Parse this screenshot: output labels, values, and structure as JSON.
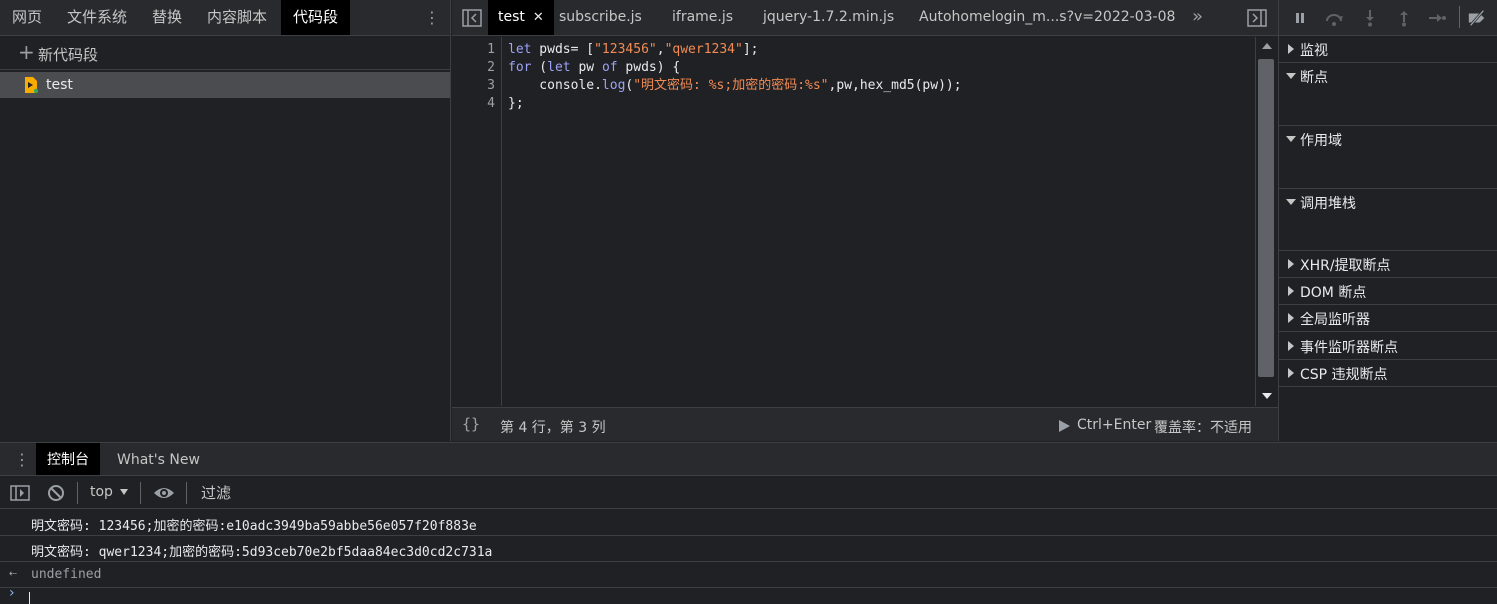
{
  "navigator": {
    "tabs": [
      "网页",
      "文件系统",
      "替换",
      "内容脚本",
      "代码段"
    ],
    "more_glyph": "⋮",
    "new_snippet_label": "新代码段",
    "snippet_name": "test"
  },
  "editor": {
    "tabs": [
      {
        "label": "test",
        "close": "✕"
      },
      {
        "label": "subscribe.js"
      },
      {
        "label": "iframe.js"
      },
      {
        "label": "jquery-1.7.2.min.js"
      },
      {
        "label": "Autohomelogin_m...s?v=2022-03-08"
      }
    ],
    "overflow_glyph": "»",
    "line_numbers": [
      "1",
      "2",
      "3",
      "4"
    ],
    "code": {
      "l1": {
        "kw": "let",
        "a": " pwds= [",
        "s1": "\"123456\"",
        "b": ",",
        "s2": "\"qwer1234\"",
        "c": "];"
      },
      "l2": {
        "kw1": "for",
        "a": " (",
        "kw2": "let",
        "b": " pw ",
        "kw3": "of",
        "c": " pwds) {"
      },
      "l3": {
        "a": "    console.",
        "fn": "log",
        "b": "(",
        "s": "\"明文密码: %s;加密的密码:%s\"",
        "c": ",pw,hex_md5(pw));"
      },
      "l4": {
        "a": "};"
      }
    },
    "status": {
      "pretty_print": "{}",
      "cursor_position": "第 4 行，第 3 列",
      "run_shortcut": "Ctrl+Enter",
      "coverage": "覆盖率：不适用"
    }
  },
  "debugger": {
    "sections": [
      "监视",
      "断点",
      "作用域",
      "调用堆栈",
      "XHR/提取断点",
      "DOM 断点",
      "全局监听器",
      "事件监听器断点",
      "CSP 违规断点"
    ]
  },
  "drawer": {
    "menu_glyph": "⋮",
    "tabs": [
      "控制台",
      "What's New"
    ]
  },
  "console": {
    "context": "top",
    "filter_placeholder": "过滤",
    "messages": [
      "明文密码: 123456;加密的密码:e10adc3949ba59abbe56e057f20f883e",
      "明文密码: qwer1234;加密的密码:5d93ceb70e2bf5daa84ec3d0cd2c731a"
    ],
    "return_glyph": "⇠",
    "return_value": "undefined",
    "prompt_glyph": "›"
  },
  "colors": {
    "keyword": "#9ba3f5",
    "string": "#f28b54",
    "prompt": "#8ab4f8",
    "background": "#202124"
  }
}
